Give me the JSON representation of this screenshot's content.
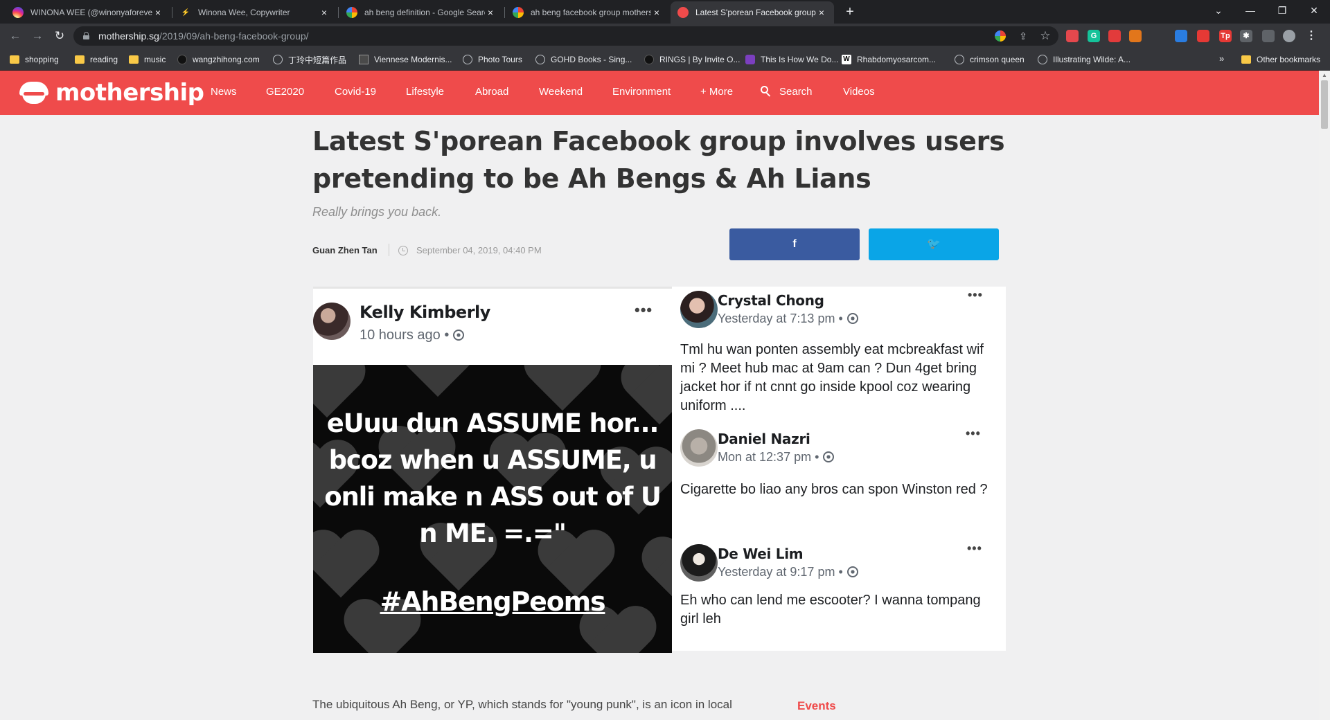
{
  "browser": {
    "tabs": [
      {
        "title": "WINONA WEE (@winonyaforever)",
        "active": false
      },
      {
        "title": "Winona Wee, Copywriter",
        "active": false
      },
      {
        "title": "ah beng definition - Google Search",
        "active": false
      },
      {
        "title": "ah beng facebook group mothership",
        "active": false
      },
      {
        "title": "Latest S'porean Facebook group",
        "active": true
      }
    ],
    "close_glyph": "×",
    "new_tab_glyph": "+",
    "window_controls": {
      "collapse": "⌄",
      "minimize": "—",
      "restore": "❐",
      "close": "✕"
    },
    "nav": {
      "back": "←",
      "forward": "→",
      "reload": "↻"
    },
    "url_host": "mothership.sg",
    "url_path": "/2019/09/ah-beng-facebook-group/",
    "omnibox_icons": {
      "share": "⇪",
      "bookmark_star": "☆"
    },
    "extensions": [
      {
        "icon": "raindrop-icon",
        "label": "",
        "color": "#e5484d"
      },
      {
        "icon": "grammarly-icon",
        "label": "G",
        "color": "#15c39a"
      },
      {
        "icon": "shield-icon",
        "label": "",
        "color": "#e23b3b"
      },
      {
        "icon": "metamask-icon",
        "label": "",
        "color": "#e2761b"
      },
      {
        "icon": "drop-icon",
        "label": "",
        "color": "#2a7de1"
      },
      {
        "icon": "bolt-icon",
        "label": "",
        "color": "#e53935"
      },
      {
        "icon": "tp-icon",
        "label": "Tp",
        "color": "#e53935"
      },
      {
        "icon": "puzzle-icon",
        "label": "✱",
        "color": "#5f6368"
      },
      {
        "icon": "sidepanel-icon",
        "label": "",
        "color": "#5f6368"
      },
      {
        "icon": "profile-icon",
        "label": "",
        "color": "#9aa0a6"
      },
      {
        "icon": "menu-icon",
        "label": "⋮",
        "color": "#35363a"
      }
    ],
    "bookmarks": [
      {
        "label": "shopping",
        "icon": "folder"
      },
      {
        "label": "reading",
        "icon": "folder"
      },
      {
        "label": "music",
        "icon": "folder"
      },
      {
        "label": "wangzhihong.com",
        "icon": "dot"
      },
      {
        "label": "丁玲中短篇作品",
        "icon": "globe"
      },
      {
        "label": "Viennese Modernis...",
        "icon": "doc"
      },
      {
        "label": "Photo Tours",
        "icon": "globe"
      },
      {
        "label": "GOHD Books - Sing...",
        "icon": "globe"
      },
      {
        "label": "RINGS | By Invite O...",
        "icon": "dot"
      },
      {
        "label": "This Is How We Do...",
        "icon": "purple"
      },
      {
        "label": "Rhabdomyosarcom...",
        "icon": "wbox"
      },
      {
        "label": "crimson queen",
        "icon": "globe"
      },
      {
        "label": "Illustrating Wilde: A...",
        "icon": "globe"
      }
    ],
    "bookmarks_more": "»",
    "other_bookmarks": "Other bookmarks"
  },
  "site": {
    "logo_text": "mothership",
    "nav": [
      "News",
      "GE2020",
      "Covid-19",
      "Lifestyle",
      "Abroad",
      "Weekend",
      "Environment",
      "+ More",
      "Search",
      "Videos"
    ],
    "brand_color": "#ef4b4b"
  },
  "article": {
    "headline": "Latest S'porean Facebook group involves users pretending to be Ah Bengs & Ah Lians",
    "subhead": "Really brings you back.",
    "author": "Guan Zhen Tan",
    "date": "September 04, 2019, 04:40 PM",
    "share": {
      "facebook": "f",
      "twitter": "🐦"
    },
    "body_start": "The ubiquitous Ah Beng, or YP, which stands for \"young punk\", is an icon in local",
    "sidebar_label": "Events"
  },
  "image": {
    "left_post": {
      "name": "Kelly Kimberly",
      "time": "10 hours ago •",
      "more": "•••",
      "quote": "eUuu dun ASSUME hor... bcoz when u ASSUME, u onli make n ASS out of U n ME. =.=\"",
      "hashtag": "#AhBengPeoms"
    },
    "right_posts": [
      {
        "name": "Crystal Chong",
        "time": "Yesterday at 7:13 pm •",
        "more": "•••",
        "body": "Tml hu wan ponten assembly eat mcbreakfast wif mi ? Meet hub mac at 9am can ? Dun 4get bring jacket hor if nt cnnt go inside kpool coz wearing uniform ...."
      },
      {
        "name": "Daniel Nazri",
        "time": "Mon at 12:37 pm •",
        "more": "•••",
        "body": "Cigarette bo liao any bros can spon Winston red ?"
      },
      {
        "name": "De Wei Lim",
        "time": "Yesterday at 9:17 pm •",
        "more": "•••",
        "body": "Eh who can lend me escooter? I wanna tompang girl leh"
      }
    ]
  }
}
